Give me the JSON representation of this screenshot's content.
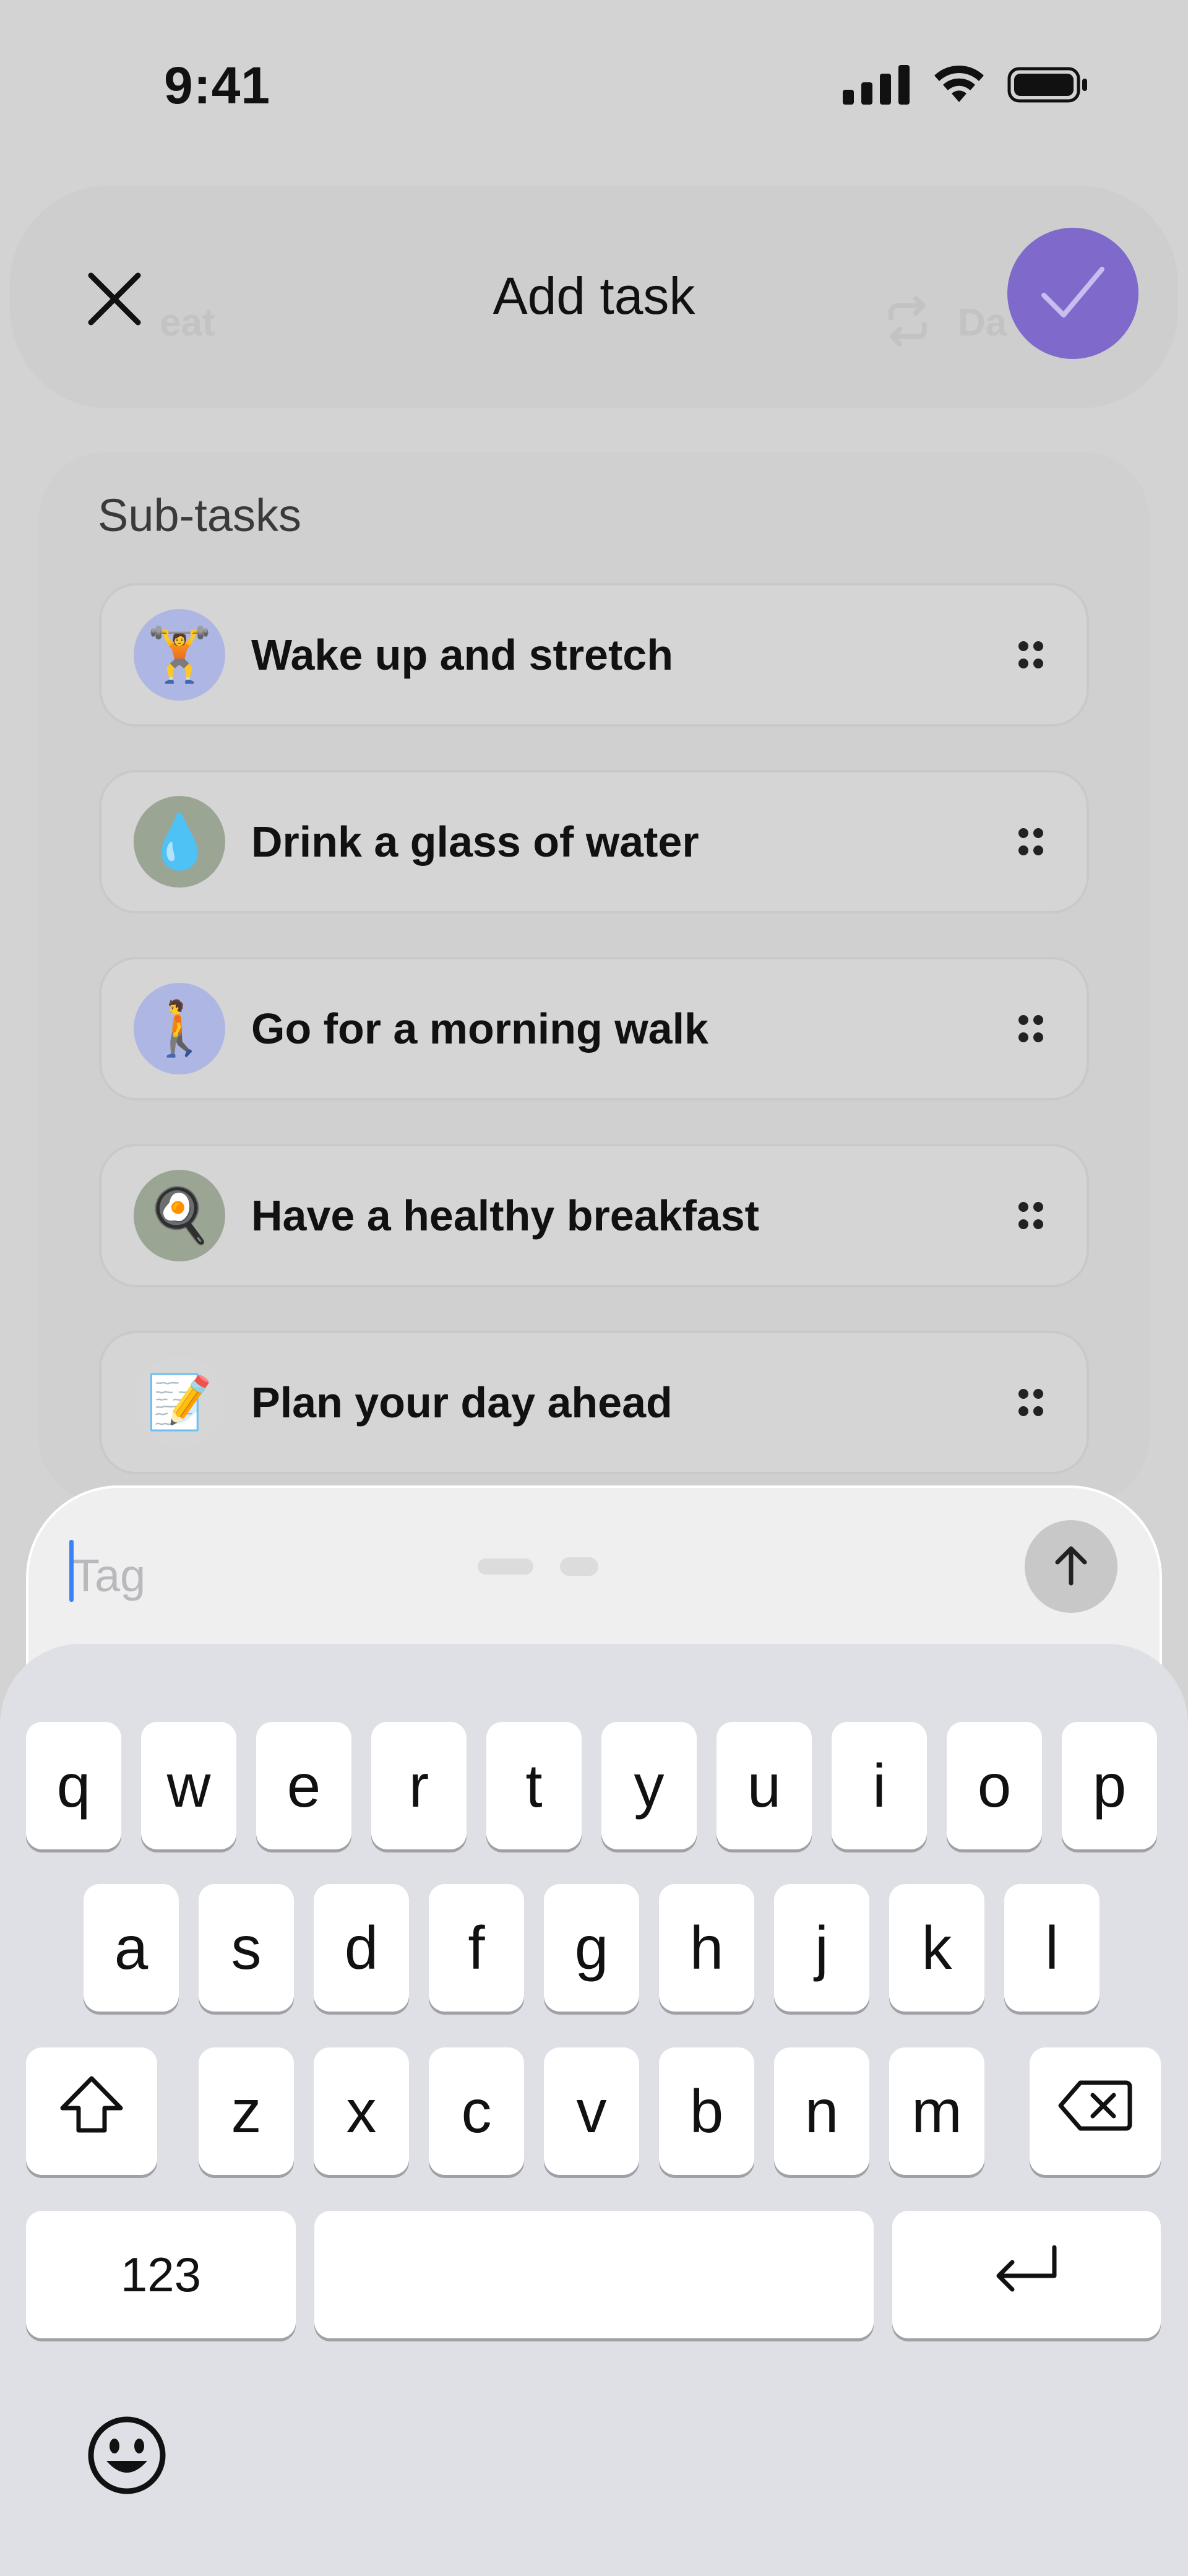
{
  "status_bar": {
    "time": "9:41"
  },
  "header": {
    "title": "Add task",
    "ghost_left": "eat",
    "ghost_right": "Da"
  },
  "subtasks": {
    "title": "Sub-tasks",
    "items": [
      {
        "label": "Wake up and stretch",
        "emoji": "🏋️",
        "bg": "#aeb6e3"
      },
      {
        "label": "Drink a glass of water",
        "emoji": "💧",
        "bg": "#9aa594"
      },
      {
        "label": "Go for a morning walk",
        "emoji": "🚶",
        "bg": "#aeb6e3"
      },
      {
        "label": "Have a healthy breakfast",
        "emoji": "🍳",
        "bg": "#9aa594"
      },
      {
        "label": "Plan your day ahead",
        "emoji": "📝",
        "bg": "#d6d6d6"
      }
    ]
  },
  "composer": {
    "placeholder": "Tag"
  },
  "keyboard": {
    "row1": [
      "q",
      "w",
      "e",
      "r",
      "t",
      "y",
      "u",
      "i",
      "o",
      "p"
    ],
    "row2": [
      "a",
      "s",
      "d",
      "f",
      "g",
      "h",
      "j",
      "k",
      "l"
    ],
    "row3": [
      "z",
      "x",
      "c",
      "v",
      "b",
      "n",
      "m"
    ],
    "numbers_label": "123"
  },
  "colors": {
    "accent": "#7f6acb",
    "caret": "#3b82f6"
  }
}
